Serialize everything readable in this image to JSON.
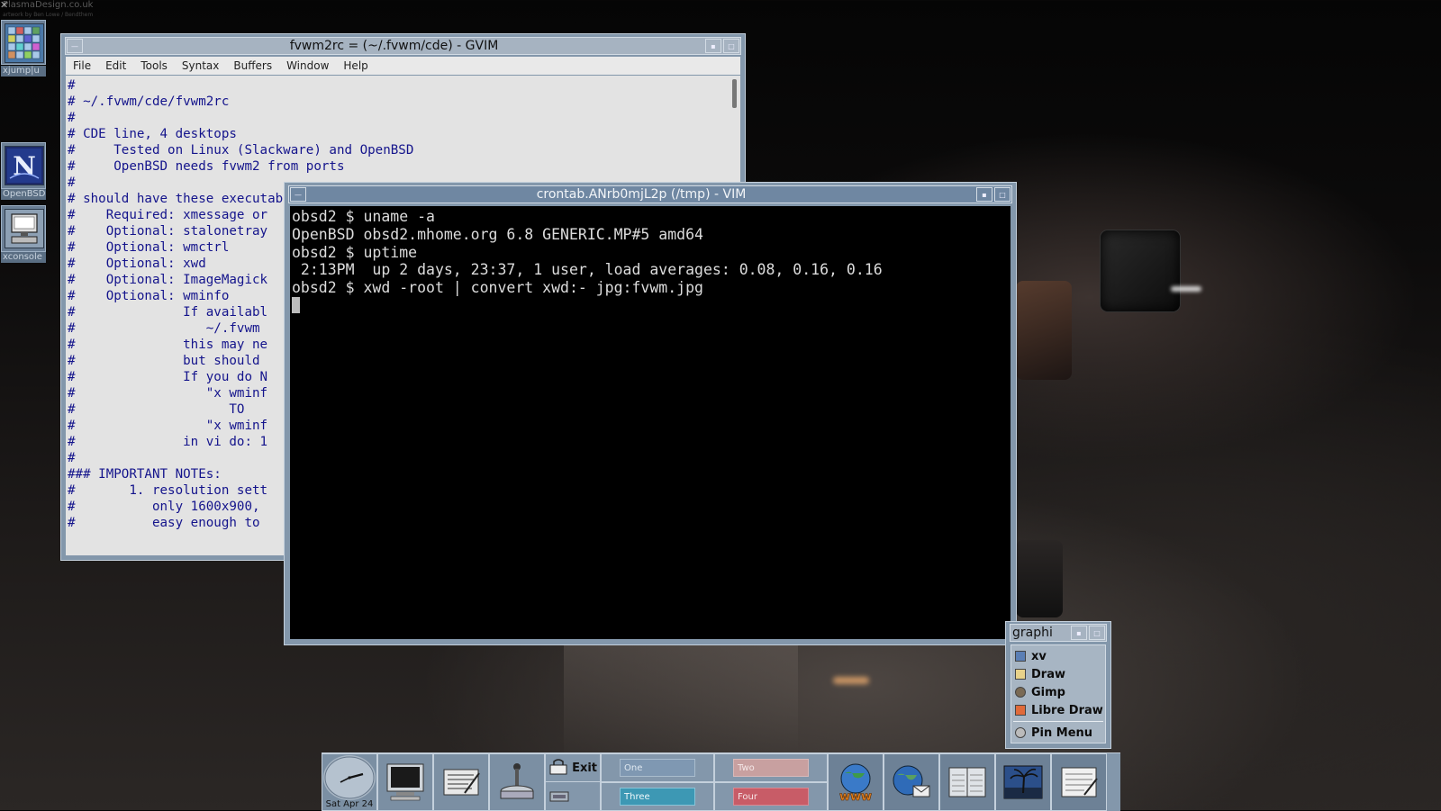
{
  "wallpaper": {
    "credit": "PlasmaDesign.co.uk",
    "credit_sub": "artwork by Ben Lowe / Bendthem"
  },
  "dock": [
    {
      "label": "xjump|u"
    },
    {
      "label": "OpenBSD"
    },
    {
      "label": "xconsole"
    }
  ],
  "gvim": {
    "title": "fvwm2rc = (~/.fvwm/cde) - GVIM",
    "menu": [
      "File",
      "Edit",
      "Tools",
      "Syntax",
      "Buffers",
      "Window",
      "Help"
    ],
    "lines": [
      "#",
      "# ~/.fvwm/cde/fvwm2rc",
      "#",
      "# CDE line, 4 desktops",
      "#     Tested on Linux (Slackware) and OpenBSD",
      "#     OpenBSD needs fvwm2 from ports",
      "#",
      "# should have these executables",
      "#    Required: xmessage or",
      "#    Optional: stalonetray",
      "#    Optional: wmctrl",
      "#    Optional: xwd",
      "#    Optional: ImageMagick",
      "#    Optional: wminfo",
      "#              If availabl",
      "#                 ~/.fvwm",
      "#              this may ne",
      "#              but should",
      "#              If you do N",
      "#                 \"x wminf",
      "#                    TO",
      "#                 \"x wminf",
      "#              in vi do: 1",
      "#",
      "### IMPORTANT NOTEs:",
      "#       1. resolution sett",
      "#          only 1600x900,",
      "#          easy enough to"
    ]
  },
  "vim": {
    "title": "crontab.ANrb0mjL2p (/tmp) - VIM",
    "lines": [
      "obsd2 $ uname -a",
      "OpenBSD obsd2.mhome.org 6.8 GENERIC.MP#5 amd64",
      "obsd2 $ uptime",
      " 2:13PM  up 2 days, 23:37, 1 user, load averages: 0.08, 0.16, 0.16",
      "obsd2 $ xwd -root | convert xwd:- jpg:fvwm.jpg"
    ]
  },
  "graphics_menu": {
    "title": "graphi",
    "items": [
      "xv",
      "Draw",
      "Gimp",
      "Libre Draw"
    ],
    "pin": "Pin Menu"
  },
  "panel": {
    "date": "Sat Apr 24",
    "exit": "Exit",
    "desktops": [
      "One",
      "Two",
      "Three",
      "Four"
    ]
  },
  "colors": {
    "frame": "#8397ab",
    "active_title": "#6f87a2",
    "desk_one": "#7f98b2",
    "desk_two": "#c8a0a0",
    "desk_three": "#3d98b4",
    "desk_four": "#c85c67"
  }
}
